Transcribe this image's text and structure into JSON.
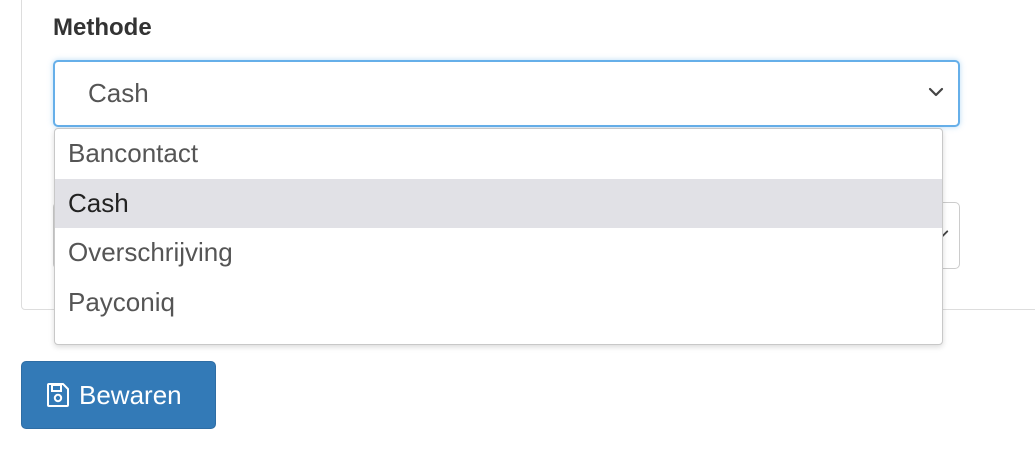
{
  "form": {
    "method_label": "Methode",
    "method_select": {
      "selected_value": "Cash",
      "options": [
        "Bancontact",
        "Cash",
        "Overschrijving",
        "Payconiq"
      ],
      "selected_index": 1
    }
  },
  "actions": {
    "save_label": "Bewaren",
    "save_icon": "save-icon"
  },
  "colors": {
    "primary": "#337ab7",
    "focus_border": "#66afe9",
    "option_highlight": "#e1e1e6"
  }
}
